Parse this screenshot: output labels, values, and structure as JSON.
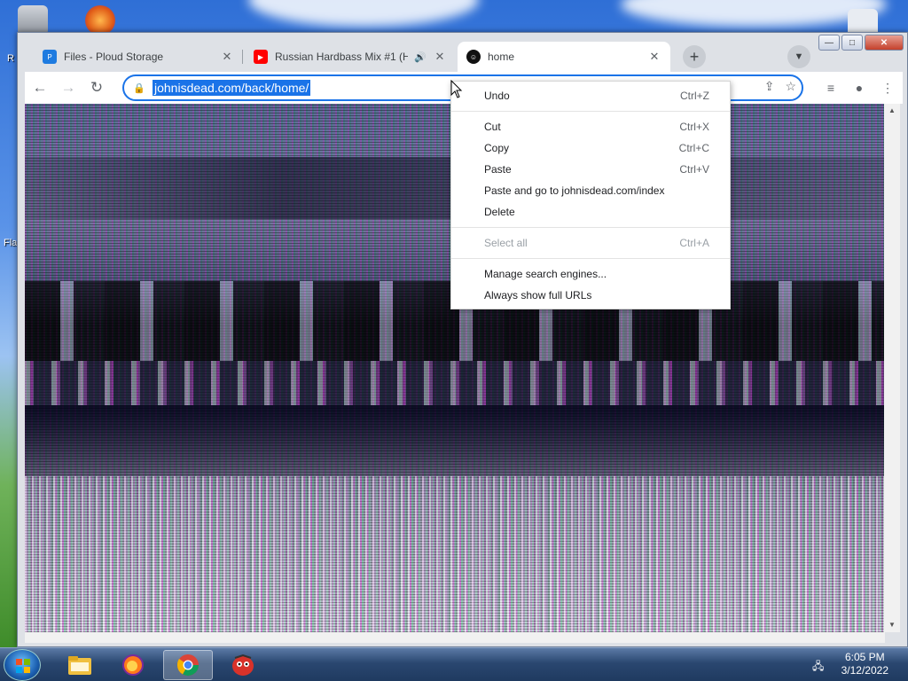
{
  "desktop": {
    "labels": [
      "R",
      "Fla"
    ]
  },
  "window": {
    "controls": {
      "minimize": "—",
      "maximize": "□",
      "close": "✕"
    }
  },
  "tabs": [
    {
      "title": "Files - Ploud Storage",
      "icon": "ploud-storage-icon",
      "icon_color": "#1e7be0",
      "active": false,
      "has_audio": false
    },
    {
      "title": "Russian Hardbass Mix #1 (Ha",
      "icon": "youtube-icon",
      "icon_color": "#ff0000",
      "active": false,
      "has_audio": true
    },
    {
      "title": "home",
      "icon": "smiley-site-icon",
      "icon_color": "#111111",
      "active": true,
      "has_audio": false
    }
  ],
  "toolbar": {
    "url": "johnisdead.com/back/home/"
  },
  "context_menu": {
    "items": [
      {
        "label": "Undo",
        "shortcut": "Ctrl+Z",
        "disabled": false
      },
      {
        "label": "Cut",
        "shortcut": "Ctrl+X",
        "disabled": false
      },
      {
        "label": "Copy",
        "shortcut": "Ctrl+C",
        "disabled": false
      },
      {
        "label": "Paste",
        "shortcut": "Ctrl+V",
        "disabled": false
      },
      {
        "label": "Paste and go to johnisdead.com/index",
        "shortcut": "",
        "disabled": false
      },
      {
        "label": "Delete",
        "shortcut": "",
        "disabled": false
      },
      {
        "label": "Select all",
        "shortcut": "Ctrl+A",
        "disabled": true
      },
      {
        "label": "Manage search engines...",
        "shortcut": "",
        "disabled": false
      },
      {
        "label": "Always show full URLs",
        "shortcut": "",
        "disabled": false
      }
    ]
  },
  "taskbar": {
    "apps": [
      {
        "name": "file-explorer",
        "active": false
      },
      {
        "name": "firefox",
        "active": false
      },
      {
        "name": "chrome",
        "active": true
      },
      {
        "name": "app-red-character",
        "active": false
      }
    ],
    "time": "6:05 PM",
    "date": "3/12/2022"
  },
  "colors": {
    "accent": "#1a73e8",
    "tab_strip": "#dee1e6"
  }
}
